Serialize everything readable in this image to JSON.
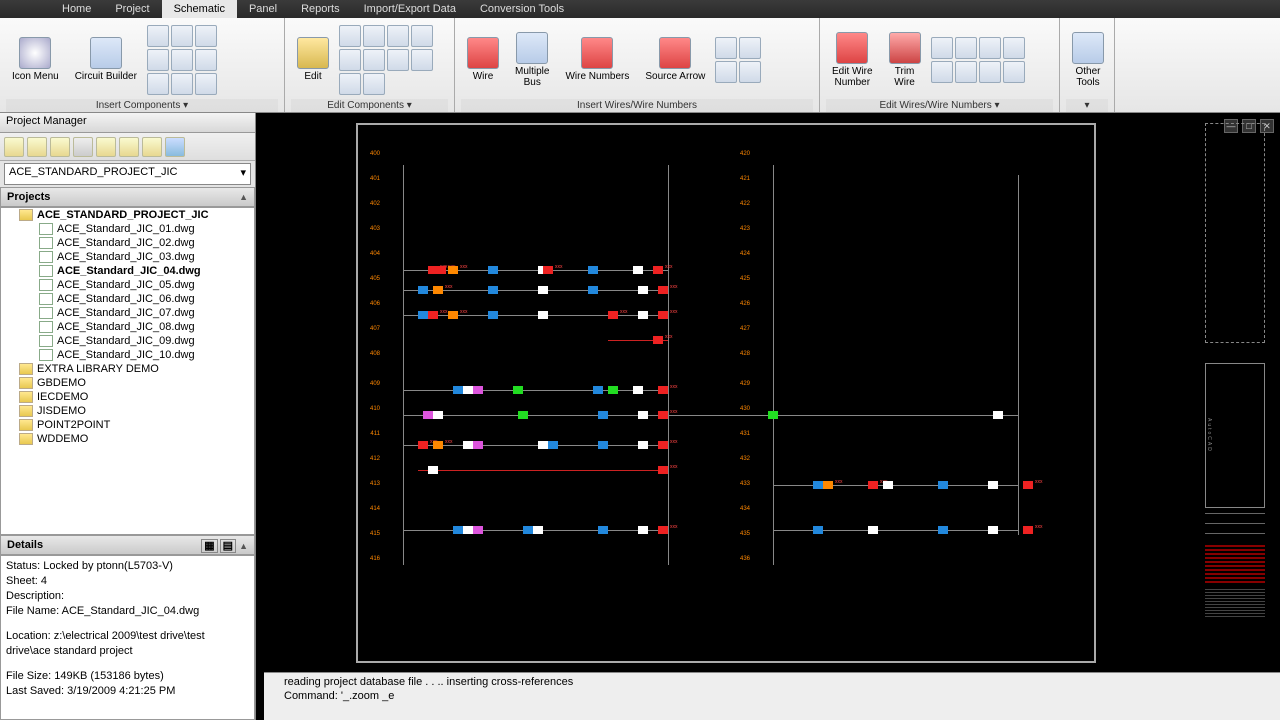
{
  "tabs": {
    "t0": "Home",
    "t1": "Project",
    "t2": "Schematic",
    "t3": "Panel",
    "t4": "Reports",
    "t5": "Import/Export Data",
    "t6": "Conversion Tools"
  },
  "ribbon": {
    "icon_menu": "Icon Menu",
    "circuit_builder": "Circuit Builder",
    "insert_components": "Insert Components ▾",
    "edit": "Edit",
    "edit_components": "Edit Components ▾",
    "wire": "Wire",
    "multiple_bus": "Multiple\nBus",
    "wire_numbers": "Wire Numbers",
    "source_arrow": "Source Arrow",
    "insert_wires": "Insert Wires/Wire Numbers",
    "edit_wire_number": "Edit Wire\nNumber",
    "trim_wire": "Trim\nWire",
    "edit_wires": "Edit Wires/Wire Numbers ▾",
    "other_tools": "Other\nTools"
  },
  "pm": {
    "title": "Project Manager",
    "selected": "ACE_STANDARD_PROJECT_JIC",
    "projects_hdr": "Projects",
    "root": "ACE_STANDARD_PROJECT_JIC",
    "files": [
      "ACE_Standard_JIC_01.dwg",
      "ACE_Standard_JIC_02.dwg",
      "ACE_Standard_JIC_03.dwg",
      "ACE_Standard_JIC_04.dwg",
      "ACE_Standard_JIC_05.dwg",
      "ACE_Standard_JIC_06.dwg",
      "ACE_Standard_JIC_07.dwg",
      "ACE_Standard_JIC_08.dwg",
      "ACE_Standard_JIC_09.dwg",
      "ACE_Standard_JIC_10.dwg"
    ],
    "extra": [
      "EXTRA LIBRARY DEMO",
      "GBDEMO",
      "IECDEMO",
      "JISDEMO",
      "POINT2POINT",
      "WDDEMO"
    ],
    "details_hdr": "Details",
    "status": "Status: Locked by ptonn(L5703-V)",
    "sheet": "Sheet: 4",
    "desc": "Description:",
    "fname": "File Name: ACE_Standard_JIC_04.dwg",
    "location": "Location: z:\\electrical 2009\\test drive\\test drive\\ace standard project",
    "fsize": "File Size: 149KB (153186 bytes)",
    "saved": "Last Saved: 3/19/2009 4:21:25 PM"
  },
  "cmd": {
    "l1": "reading project database file . . .. inserting cross-references",
    "l2": "Command: '_.zoom _e"
  }
}
